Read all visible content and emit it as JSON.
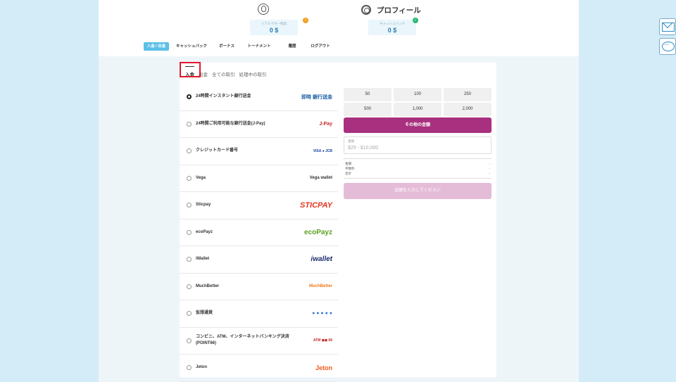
{
  "header": {
    "profile_title": "プロフィール",
    "balances": [
      {
        "label": "リアルマネー残高",
        "value": "0 $",
        "badge": "!",
        "badge_color": "#f0a020"
      },
      {
        "label": "キャッシュバック",
        "value": "0 $",
        "badge": "✓",
        "badge_color": "#2bb673"
      }
    ]
  },
  "nav": [
    {
      "label": "入金 / 出金",
      "active": true
    },
    {
      "label": "キャッシュバック"
    },
    {
      "label": "ボーナス"
    },
    {
      "label": "トーナメント"
    },
    {
      "label": "履歴"
    },
    {
      "label": "ログアウト"
    }
  ],
  "tabs": [
    {
      "label": "入金",
      "active": true
    },
    {
      "label": "出金"
    },
    {
      "label": "全ての取引"
    },
    {
      "label": "処理中の取引"
    }
  ],
  "methods": [
    {
      "label": "24時間インスタント銀行送金",
      "logo": "即時 銀行送金",
      "logo_color": "#1a5fa8",
      "checked": true
    },
    {
      "label": "24時間ご利用可能な銀行送金(J-Pay)",
      "logo": "J-Pay",
      "logo_color": "#c62828"
    },
    {
      "label": "クレジットカード番号",
      "logo": "VISA ● JCB",
      "logo_color": "#1a3fa0"
    },
    {
      "label": "Vega",
      "logo": "Vega wallet",
      "logo_color": "#333"
    },
    {
      "label": "Sticpay",
      "logo": "STICPAY",
      "logo_color": "#e8351f"
    },
    {
      "label": "ecoPayz",
      "logo": "ecoPayz",
      "logo_color": "#5aa020"
    },
    {
      "label": "iWallet",
      "logo": "iwallet",
      "logo_color": "#1a2a6a"
    },
    {
      "label": "MuchBetter",
      "logo": "MuchBetter",
      "logo_color": "#f07a1a"
    },
    {
      "label": "仮想通貨",
      "logo": "● ● ● ● ●",
      "logo_color": "#3a7bd5"
    },
    {
      "label": "コンビニ、ATM、インターネットバンキング決済(POINT66)",
      "logo": "ATM ◼◼ 66",
      "logo_color": "#c62828"
    },
    {
      "label": "Jeton",
      "logo": "Jeton",
      "logo_color": "#f05a1a"
    }
  ],
  "amounts": [
    "50",
    "100",
    "250",
    "500",
    "1,000",
    "2,000"
  ],
  "other_amount_label": "その他の金額",
  "amount_field": {
    "label": "金額",
    "placeholder": "$25 - $10,000"
  },
  "summary": [
    {
      "label": "金額",
      "value": "-"
    },
    {
      "label": "手数料",
      "value": "-"
    },
    {
      "label": "合計",
      "value": "-"
    }
  ],
  "submit_label": "金額を入力してください"
}
